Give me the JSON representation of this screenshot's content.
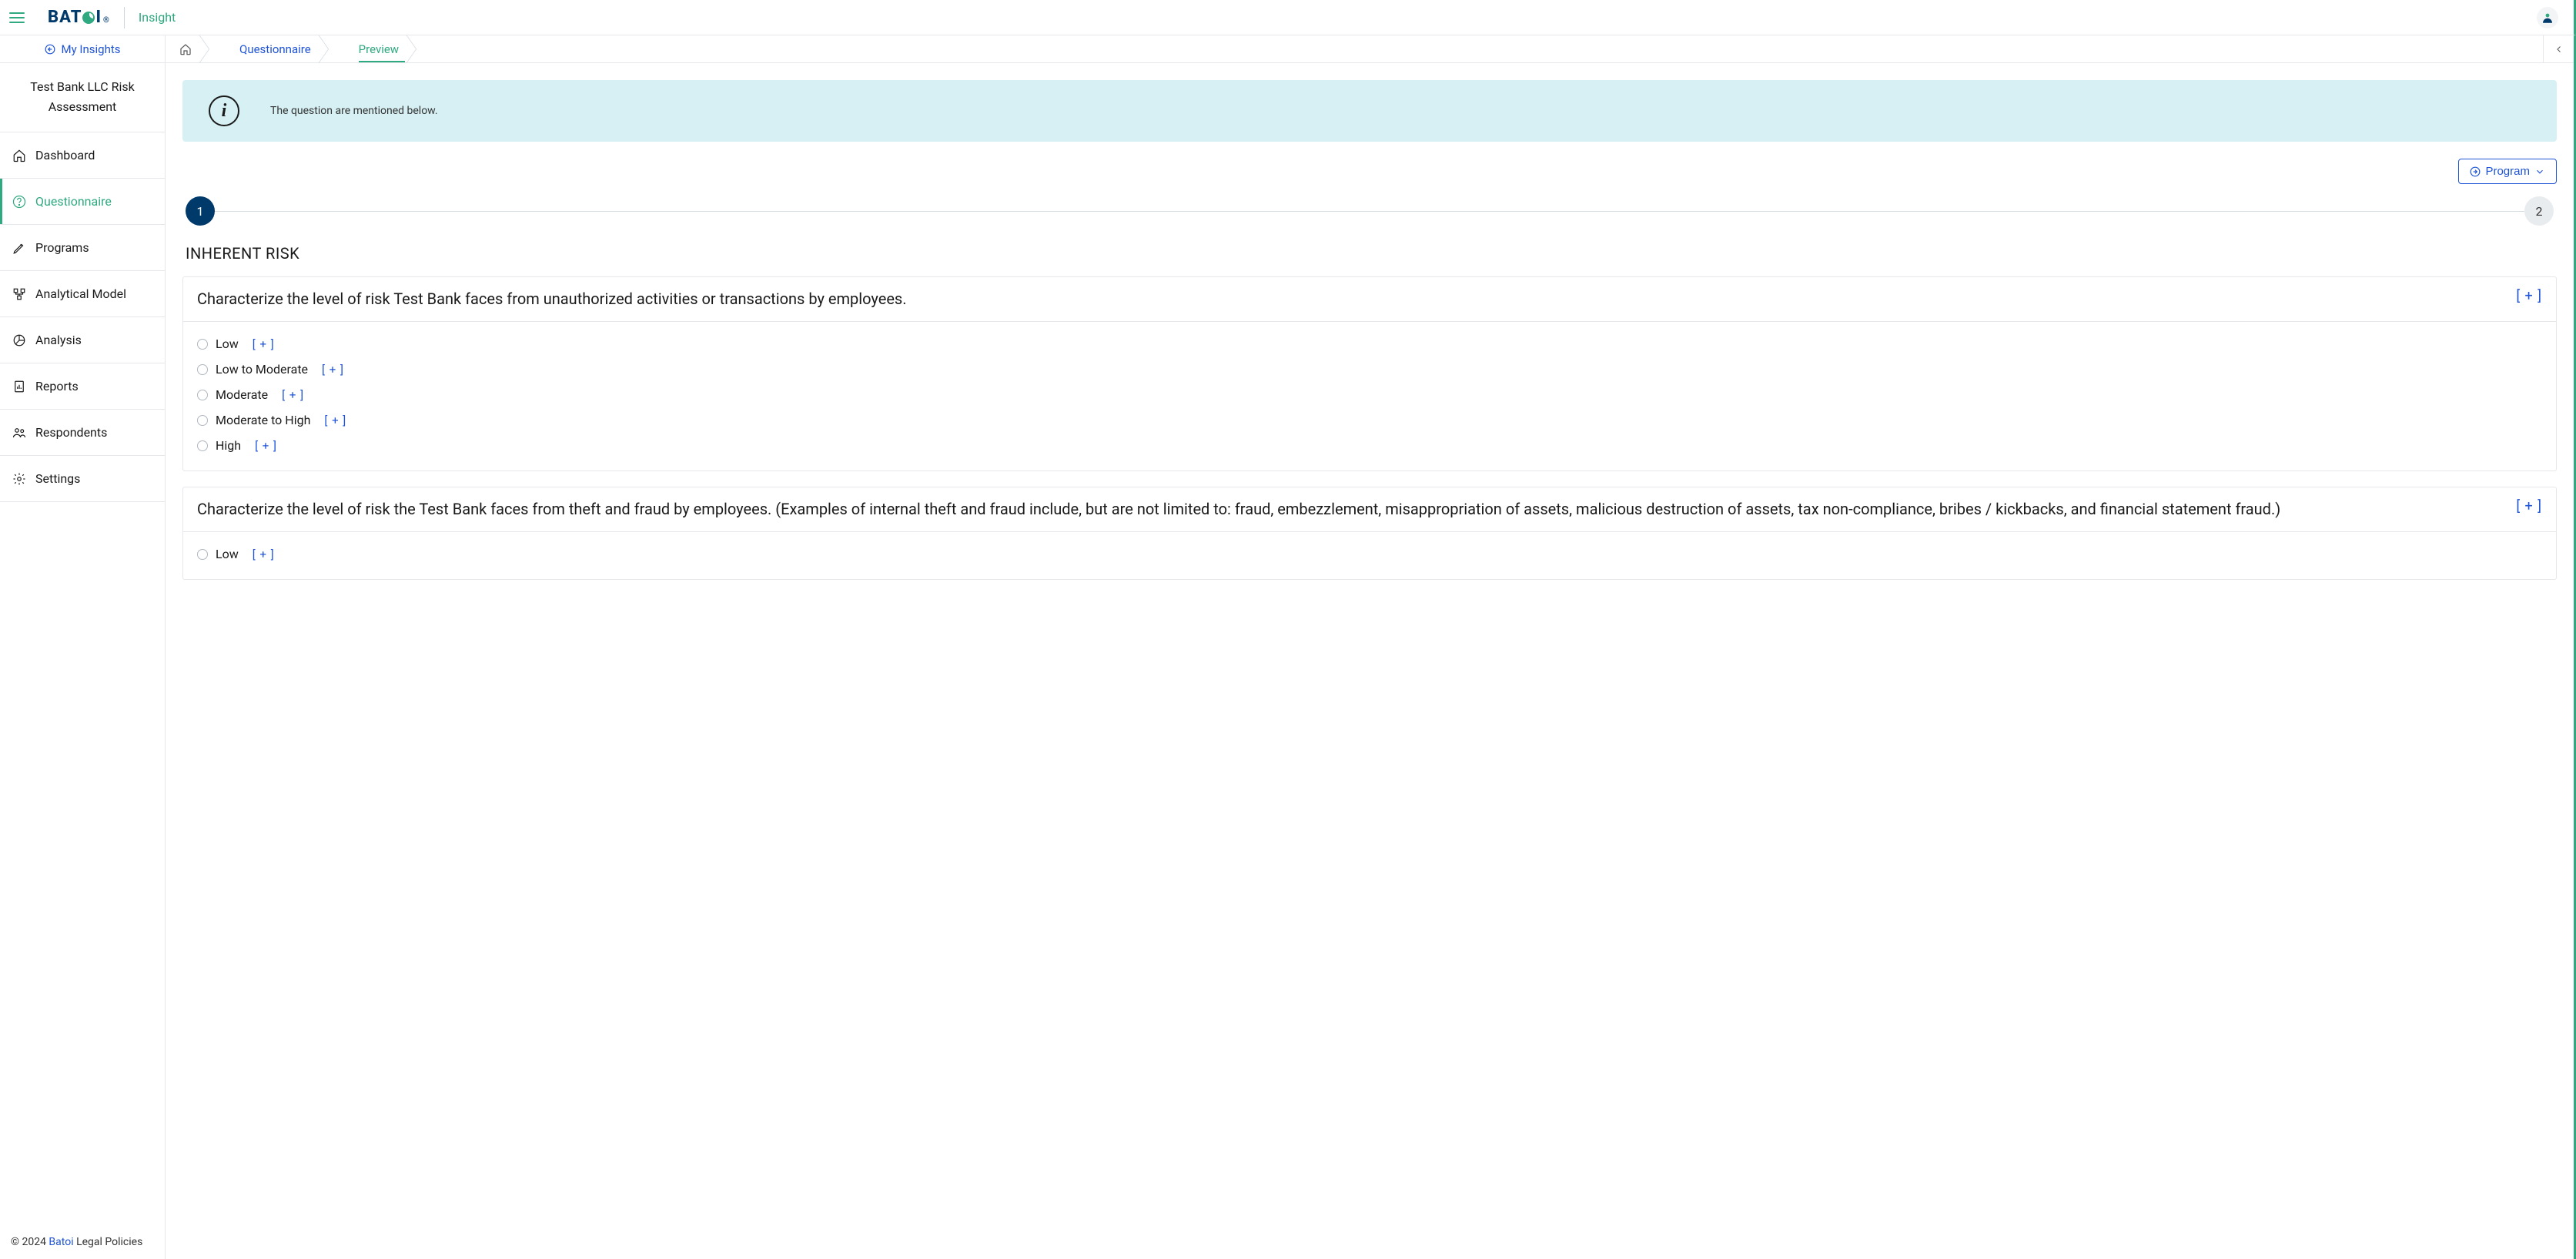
{
  "header": {
    "brand_left": "BAT",
    "brand_right": "I",
    "reg": "®",
    "product": "Insight"
  },
  "sidebar": {
    "my_insights": "My Insights",
    "assessment_title": "Test Bank LLC Risk Assessment",
    "items": [
      {
        "label": "Dashboard"
      },
      {
        "label": "Questionnaire"
      },
      {
        "label": "Programs"
      },
      {
        "label": "Analytical Model"
      },
      {
        "label": "Analysis"
      },
      {
        "label": "Reports"
      },
      {
        "label": "Respondents"
      },
      {
        "label": "Settings"
      }
    ],
    "footer_copyright": "© 2024 ",
    "footer_brand": "Batoi",
    "footer_rest": " Legal Policies"
  },
  "breadcrumb": {
    "items": [
      "Questionnaire",
      "Preview"
    ]
  },
  "banner": {
    "text": "The question are mentioned below."
  },
  "toolbar": {
    "program_label": "Program"
  },
  "stepper": {
    "steps": [
      "1",
      "2"
    ]
  },
  "section": {
    "title": "INHERENT RISK"
  },
  "expand_token": "[ + ]",
  "questions": [
    {
      "text": "Characterize the level of risk Test Bank faces from unauthorized activities or transactions by employees.",
      "options": [
        "Low",
        "Low to Moderate",
        "Moderate",
        "Moderate to High",
        "High"
      ]
    },
    {
      "text": "Characterize the level of risk the Test Bank faces from theft and fraud by employees. (Examples of internal theft and fraud include, but are not limited to: fraud, embezzlement, misappropriation of assets, malicious destruction of assets, tax non-compliance, bribes / kickbacks, and financial statement fraud.)",
      "options": [
        "Low"
      ]
    }
  ]
}
